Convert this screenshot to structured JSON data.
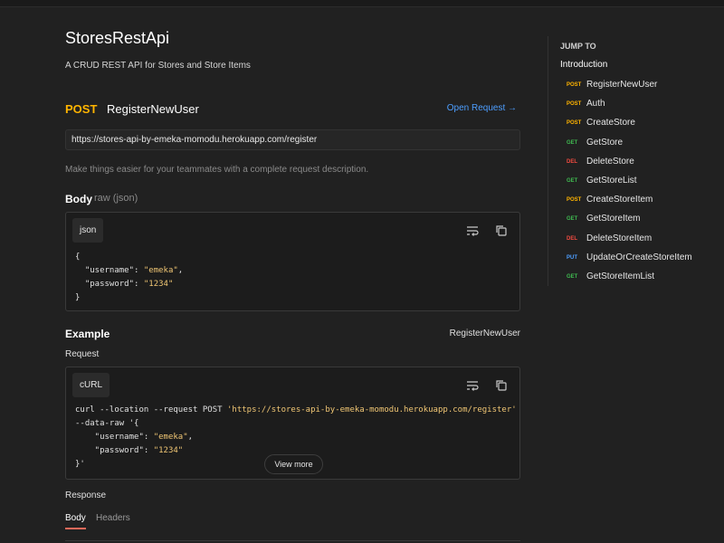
{
  "page": {
    "title": "StoresRestApi",
    "subtitle": "A CRUD REST API for Stores and Store Items"
  },
  "request": {
    "method": "POST",
    "name": "RegisterNewUser",
    "open_label": "Open Request →",
    "url": "https://stores-api-by-emeka-momodu.herokuapp.com/register",
    "description_placeholder": "Make things easier for your teammates with a complete request description.",
    "body_label": "Body",
    "body_type": "raw (json)",
    "body_lang": "json",
    "body_lines": [
      "{",
      "  \"username\": ",
      "\"emeka\"",
      ",",
      "  \"password\": ",
      "\"1234\"",
      "}"
    ]
  },
  "example": {
    "label": "Example",
    "name": "RegisterNewUser",
    "request_label": "Request",
    "lang": "cURL",
    "curl_line1_cmd": "curl --location --request POST ",
    "curl_line1_url": "'https://stores-api-by-emeka-momodu.herokuapp.com/register'",
    "curl_line2": "--data-raw '{",
    "curl_line3_key": "    \"username\": ",
    "curl_line3_val": "\"emeka\"",
    "curl_line4_key": "    \"password\": ",
    "curl_line4_val": "\"1234\"",
    "curl_line5": "}'",
    "view_more": "View more",
    "response_label": "Response",
    "tabs": [
      "Body",
      "Headers"
    ]
  },
  "sidebar": {
    "jump_to": "JUMP TO",
    "intro": "Introduction",
    "items": [
      {
        "method": "POST",
        "label": "RegisterNewUser"
      },
      {
        "method": "POST",
        "label": "Auth"
      },
      {
        "method": "POST",
        "label": "CreateStore"
      },
      {
        "method": "GET",
        "label": "GetStore"
      },
      {
        "method": "DEL",
        "label": "DeleteStore"
      },
      {
        "method": "GET",
        "label": "GetStoreList"
      },
      {
        "method": "POST",
        "label": "CreateStoreItem"
      },
      {
        "method": "GET",
        "label": "GetStoreItem"
      },
      {
        "method": "DEL",
        "label": "DeleteStoreItem"
      },
      {
        "method": "PUT",
        "label": "UpdateOrCreateStoreItem"
      },
      {
        "method": "GET",
        "label": "GetStoreItemList"
      }
    ]
  },
  "colors": {
    "POST": "#ffb400",
    "GET": "#3fb950",
    "DEL": "#f04a40",
    "PUT": "#4d9eff"
  }
}
